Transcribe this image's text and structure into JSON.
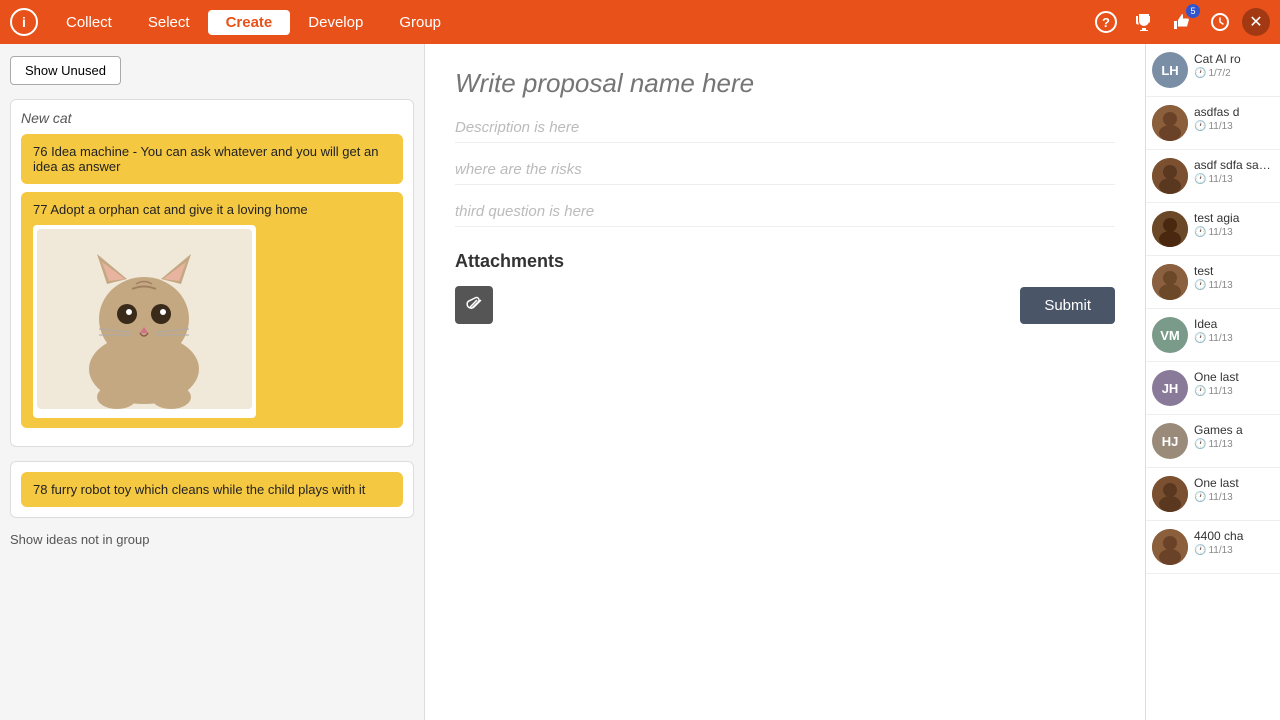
{
  "nav": {
    "links": [
      {
        "label": "Collect",
        "active": false
      },
      {
        "label": "Select",
        "active": false
      },
      {
        "label": "Create",
        "active": true
      },
      {
        "label": "Develop",
        "active": false
      },
      {
        "label": "Group",
        "active": false
      }
    ],
    "icons": {
      "badge_count": "5"
    }
  },
  "sidebar": {
    "show_unused_label": "Show Unused",
    "group_title": "New cat",
    "ideas": [
      {
        "id": "76",
        "text": "76 Idea machine - You can ask whatever and you will get an idea as answer",
        "has_image": false
      },
      {
        "id": "77",
        "text": "77 Adopt a orphan cat and give it a loving home",
        "has_image": true
      },
      {
        "id": "78",
        "text": "78 furry robot toy which cleans while the child plays with it",
        "has_image": false
      }
    ],
    "show_not_in_group": "Show ideas not in group"
  },
  "proposal": {
    "name_placeholder": "Write proposal name here",
    "question1": "Description is here",
    "question2": "where are the risks",
    "question3": "third question is here",
    "attachments_label": "Attachments",
    "submit_label": "Submit"
  },
  "right_panel": {
    "items": [
      {
        "initials": "LH",
        "avatar_type": "initials",
        "color": "initials-lh",
        "title": "Cat AI ro",
        "date": "1/7/2"
      },
      {
        "initials": null,
        "avatar_type": "image",
        "color": "brown",
        "title": "asdfas d",
        "date": "11/13"
      },
      {
        "initials": null,
        "avatar_type": "image",
        "color": "brown",
        "title": "asdf sdfa safd sad",
        "date": "11/13"
      },
      {
        "initials": null,
        "avatar_type": "image",
        "color": "brown",
        "title": "test agia",
        "date": "11/13"
      },
      {
        "initials": null,
        "avatar_type": "image",
        "color": "brown",
        "title": "test",
        "date": "11/13"
      },
      {
        "initials": "VM",
        "avatar_type": "initials",
        "color": "initials-vm",
        "title": "Idea",
        "date": "11/13"
      },
      {
        "initials": "JH",
        "avatar_type": "initials",
        "color": "initials-jh",
        "title": "One last",
        "date": "11/13"
      },
      {
        "initials": "HJ",
        "avatar_type": "initials",
        "color": "initials-hj",
        "title": "Games a",
        "date": "11/13"
      },
      {
        "initials": null,
        "avatar_type": "image",
        "color": "brown",
        "title": "One last",
        "date": "11/13"
      },
      {
        "initials": null,
        "avatar_type": "image",
        "color": "brown",
        "title": "4400 cha",
        "date": "11/13"
      }
    ]
  }
}
